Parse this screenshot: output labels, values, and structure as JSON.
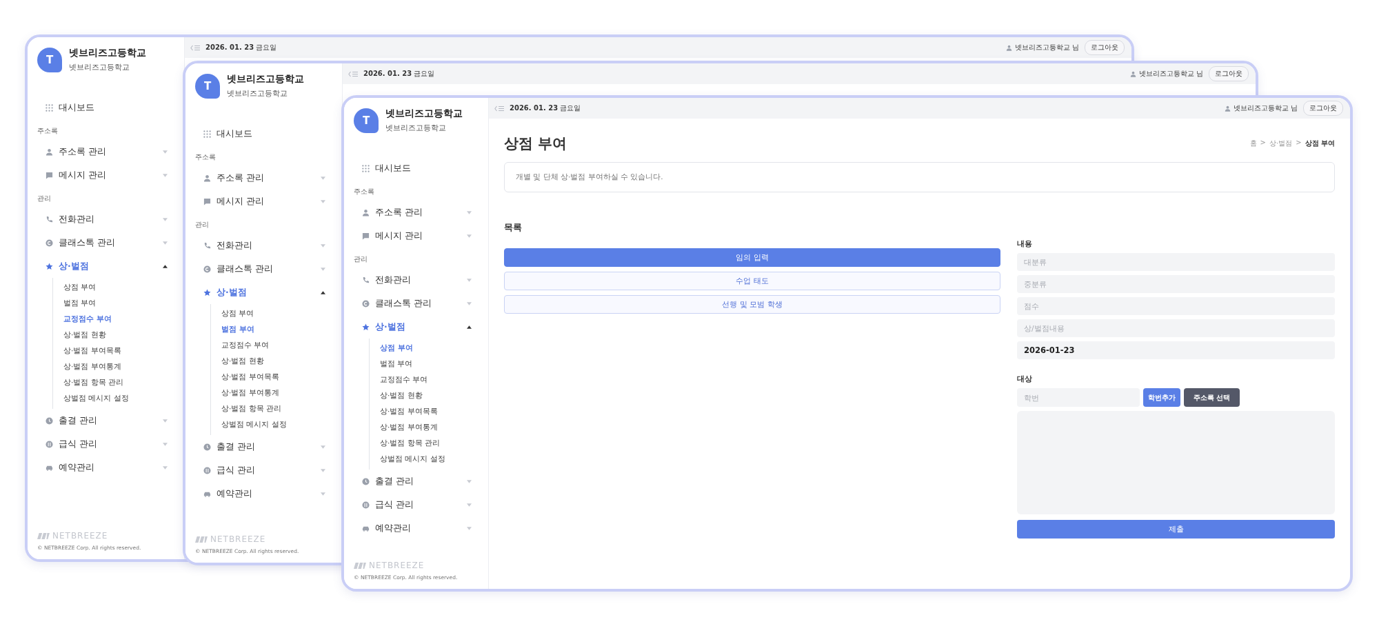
{
  "windows": [
    {
      "sidebar": {
        "avatar_letter": "T",
        "school_name": "넷브리즈고등학교",
        "school_subtitle": "넷브리즈고등학교",
        "nav": [
          {
            "kind": "link",
            "label": "대시보드"
          },
          {
            "kind": "section",
            "label": "주소록"
          },
          {
            "kind": "group",
            "label": "주소록 관리",
            "expanded": false
          },
          {
            "kind": "group",
            "label": "메시지 관리",
            "expanded": false
          },
          {
            "kind": "section",
            "label": "관리"
          },
          {
            "kind": "group",
            "label": "전화관리",
            "expanded": false
          },
          {
            "kind": "group",
            "label": "클래스톡 관리",
            "expanded": false
          },
          {
            "kind": "group",
            "label": "상·벌점",
            "expanded": true,
            "children": [
              {
                "label": "상점 부여",
                "selected": false
              },
              {
                "label": "벌점 부여",
                "selected": false
              },
              {
                "label": "교정점수 부여",
                "selected": true
              },
              {
                "label": "상·벌점 현황",
                "selected": false
              },
              {
                "label": "상·벌점 부여목록",
                "selected": false
              },
              {
                "label": "상·벌점 부여통계",
                "selected": false
              },
              {
                "label": "상·벌점 항목 관리",
                "selected": false
              },
              {
                "label": "상벌점 메시지 설정",
                "selected": false
              }
            ]
          },
          {
            "kind": "group",
            "label": "출결 관리",
            "expanded": false
          },
          {
            "kind": "group",
            "label": "급식 관리",
            "expanded": false
          },
          {
            "kind": "group",
            "label": "예약관리",
            "expanded": false
          }
        ],
        "brand": "NETBREEZE",
        "copyright": "© NETBREEZE Corp. All rights reserved."
      },
      "top_bar": {
        "date": "**2026. 01. 23** 금요일",
        "user": "넷브리즈고등학교 님",
        "logout": "로그아웃"
      }
    },
    {
      "sidebar": {
        "avatar_letter": "T",
        "school_name": "넷브리즈고등학교",
        "school_subtitle": "넷브리즈고등학교",
        "nav": [
          {
            "kind": "link",
            "label": "대시보드"
          },
          {
            "kind": "section",
            "label": "주소록"
          },
          {
            "kind": "group",
            "label": "주소록 관리",
            "expanded": false
          },
          {
            "kind": "group",
            "label": "메시지 관리",
            "expanded": false
          },
          {
            "kind": "section",
            "label": "관리"
          },
          {
            "kind": "group",
            "label": "전화관리",
            "expanded": false
          },
          {
            "kind": "group",
            "label": "클래스톡 관리",
            "expanded": false
          },
          {
            "kind": "group",
            "label": "상·벌점",
            "expanded": true,
            "children": [
              {
                "label": "상점 부여",
                "selected": false
              },
              {
                "label": "벌점 부여",
                "selected": true
              },
              {
                "label": "교정점수 부여",
                "selected": false
              },
              {
                "label": "상·벌점 현황",
                "selected": false
              },
              {
                "label": "상·벌점 부여목록",
                "selected": false
              },
              {
                "label": "상·벌점 부여통계",
                "selected": false
              },
              {
                "label": "상·벌점 항목 관리",
                "selected": false
              },
              {
                "label": "상벌점 메시지 설정",
                "selected": false
              }
            ]
          },
          {
            "kind": "group",
            "label": "출결 관리",
            "expanded": false
          },
          {
            "kind": "group",
            "label": "급식 관리",
            "expanded": false
          },
          {
            "kind": "group",
            "label": "예약관리",
            "expanded": false
          }
        ],
        "brand": "NETBREEZE",
        "copyright": "© NETBREEZE Corp. All rights reserved."
      },
      "top_bar": {
        "date": "**2026. 01. 23** 금요일",
        "user": "넷브리즈고등학교 님",
        "logout": "로그아웃"
      }
    },
    {
      "sidebar": {
        "avatar_letter": "T",
        "school_name": "넷브리즈고등학교",
        "school_subtitle": "넷브리즈고등학교",
        "nav": [
          {
            "kind": "link",
            "label": "대시보드"
          },
          {
            "kind": "section",
            "label": "주소록"
          },
          {
            "kind": "group",
            "label": "주소록 관리",
            "expanded": false
          },
          {
            "kind": "group",
            "label": "메시지 관리",
            "expanded": false
          },
          {
            "kind": "section",
            "label": "관리"
          },
          {
            "kind": "group",
            "label": "전화관리",
            "expanded": false
          },
          {
            "kind": "group",
            "label": "클래스톡 관리",
            "expanded": false
          },
          {
            "kind": "group",
            "label": "상·벌점",
            "expanded": true,
            "children": [
              {
                "label": "상점 부여",
                "selected": true
              },
              {
                "label": "벌점 부여",
                "selected": false
              },
              {
                "label": "교정점수 부여",
                "selected": false
              },
              {
                "label": "상·벌점 현황",
                "selected": false
              },
              {
                "label": "상·벌점 부여목록",
                "selected": false
              },
              {
                "label": "상·벌점 부여통계",
                "selected": false
              },
              {
                "label": "상·벌점 항목 관리",
                "selected": false
              },
              {
                "label": "상벌점 메시지 설정",
                "selected": false
              }
            ]
          },
          {
            "kind": "group",
            "label": "출결 관리",
            "expanded": false
          },
          {
            "kind": "group",
            "label": "급식 관리",
            "expanded": false
          },
          {
            "kind": "group",
            "label": "예약관리",
            "expanded": false
          }
        ],
        "brand": "NETBREEZE",
        "copyright": "© NETBREEZE Corp. All rights reserved."
      },
      "top_bar": {
        "date": "**2026. 01. 23** 금요일",
        "user": "넷브리즈고등학교 님",
        "logout": "로그아웃"
      },
      "page": {
        "title": "상점 부여",
        "breadcrumb": {
          "items": [
            "홈",
            "상·벌점",
            "상점 부여"
          ],
          "separator": ">"
        },
        "description": "개별 및 단체 상·벌점 부여하실 수 있습니다.",
        "list_title": "목록",
        "list": [
          {
            "label": "임의 입력",
            "selected": true
          },
          {
            "label": "수업 태도",
            "selected": false
          },
          {
            "label": "선행 및 모범 학생",
            "selected": false
          }
        ],
        "content_label": "내용",
        "fields": [
          {
            "placeholder": "대분류"
          },
          {
            "placeholder": "중분류"
          },
          {
            "placeholder": "점수"
          },
          {
            "placeholder": "상/벌점내용"
          },
          {
            "value": "2026-01-23"
          }
        ],
        "target_label": "대상",
        "student_field": {
          "placeholder": "학번"
        },
        "add_button": "학번추가",
        "address_button": "주소록 선택",
        "submit": "제출"
      }
    }
  ]
}
